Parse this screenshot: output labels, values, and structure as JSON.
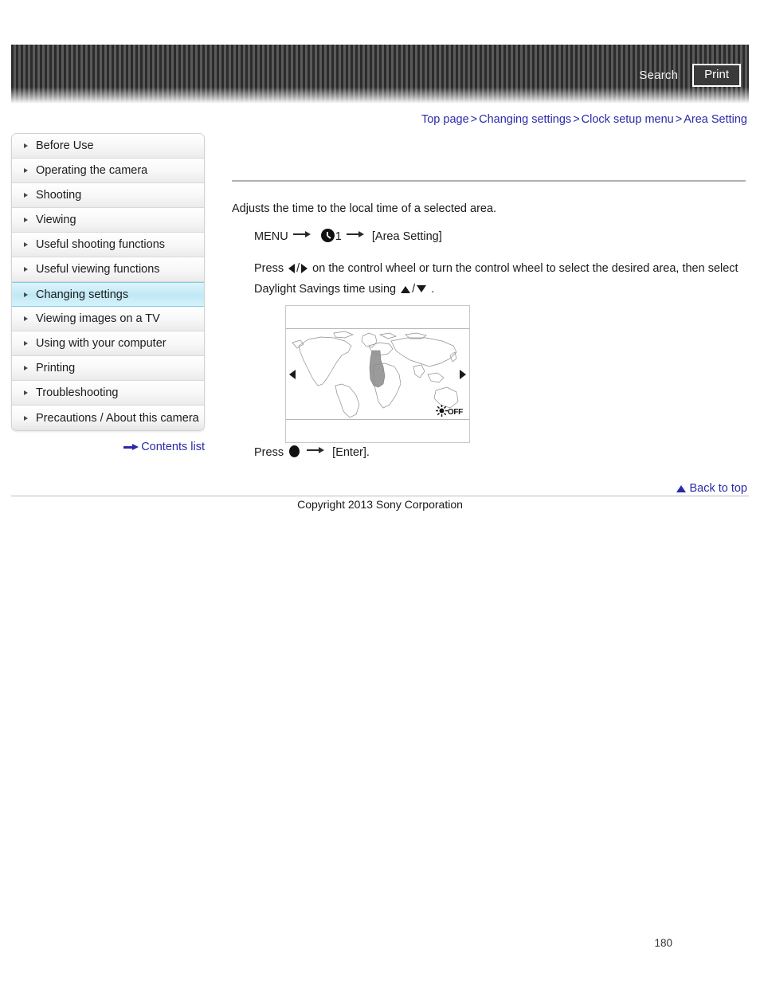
{
  "header": {
    "search_label": "Search",
    "print_label": "Print"
  },
  "breadcrumb": {
    "items": [
      {
        "label": "Top page"
      },
      {
        "label": "Changing settings"
      },
      {
        "label": "Clock setup menu"
      },
      {
        "label": "Area Setting"
      }
    ],
    "separator": ">"
  },
  "sidebar": {
    "items": [
      {
        "label": "Before Use",
        "active": false
      },
      {
        "label": "Operating the camera",
        "active": false
      },
      {
        "label": "Shooting",
        "active": false
      },
      {
        "label": "Viewing",
        "active": false
      },
      {
        "label": "Useful shooting functions",
        "active": false
      },
      {
        "label": "Useful viewing functions",
        "active": false
      },
      {
        "label": "Changing settings",
        "active": true
      },
      {
        "label": "Viewing images on a TV",
        "active": false
      },
      {
        "label": "Using with your computer",
        "active": false
      },
      {
        "label": "Printing",
        "active": false
      },
      {
        "label": "Troubleshooting",
        "active": false
      },
      {
        "label": "Precautions / About this camera",
        "active": false
      }
    ],
    "contents_list_label": "Contents list"
  },
  "content": {
    "intro": "Adjusts the time to the local time of a selected area.",
    "menu_step": {
      "menu_label": "MENU",
      "clock_index": "1",
      "target": "[Area Setting]"
    },
    "press_step": {
      "prefix": "Press",
      "middle": "on the control wheel or turn the control wheel to select the desired area, then select",
      "second_line": "Daylight Savings time using",
      "period": "."
    },
    "enter_step": {
      "prefix": "Press",
      "target": "[Enter]."
    }
  },
  "figure": {
    "dst_state_label": "OFF",
    "alt": "world-map-area-selection"
  },
  "footer": {
    "back_to_top": "Back to top",
    "copyright": "Copyright 2013 Sony Corporation",
    "page_number": "180"
  },
  "colors": {
    "link": "#2a2aa8",
    "active_sidebar": "#bfe9f6",
    "rule": "#b0b0b0"
  }
}
